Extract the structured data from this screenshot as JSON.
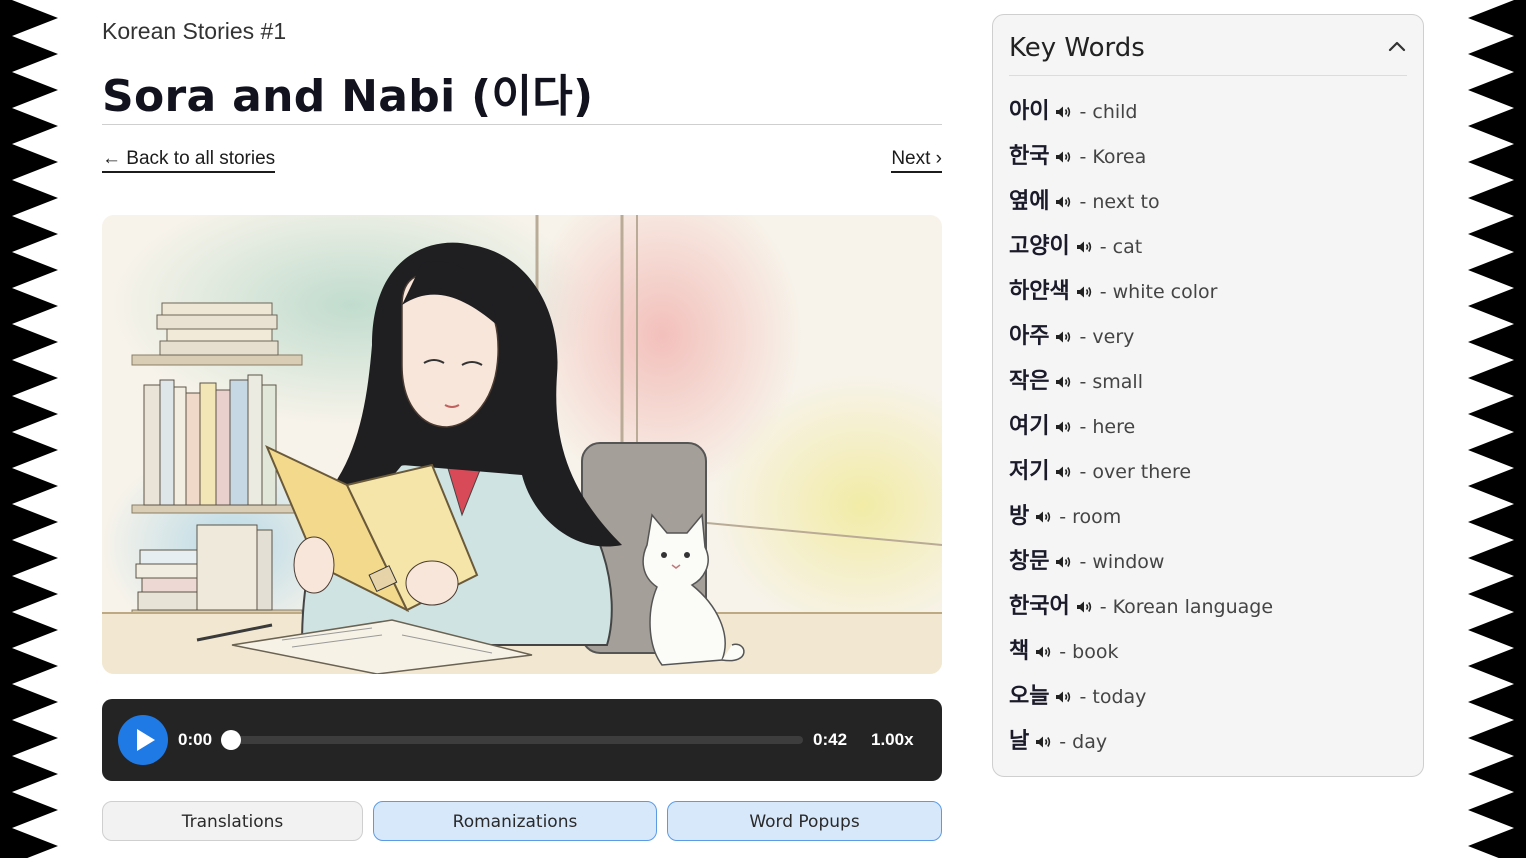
{
  "header": {
    "series": "Korean Stories #1",
    "title": "Sora and Nabi (이다)"
  },
  "nav": {
    "back": "← Back to all stories",
    "next": "Next ›"
  },
  "illustration": {
    "subject": "girl-reading-with-cat"
  },
  "player": {
    "current_time": "0:00",
    "duration": "0:42",
    "speed": "1.00x",
    "progress": 0,
    "play_icon": "play-icon",
    "accent_color": "#1f7ae6"
  },
  "toggles": [
    {
      "label": "Translations",
      "active": false
    },
    {
      "label": "Romanizations",
      "active": true
    },
    {
      "label": "Word Popups",
      "active": true
    }
  ],
  "key_words": {
    "title": "Key Words",
    "collapse_icon": "chevron-up-icon",
    "speaker_icon": "speaker-icon",
    "items": [
      {
        "korean": "아이",
        "english": "- child"
      },
      {
        "korean": "한국",
        "english": "- Korea"
      },
      {
        "korean": "옆에",
        "english": "- next to"
      },
      {
        "korean": "고양이",
        "english": "- cat"
      },
      {
        "korean": "하얀색",
        "english": "- white color"
      },
      {
        "korean": "아주",
        "english": "- very"
      },
      {
        "korean": "작은",
        "english": "- small"
      },
      {
        "korean": "여기",
        "english": "- here"
      },
      {
        "korean": "저기",
        "english": "- over there"
      },
      {
        "korean": "방",
        "english": "- room"
      },
      {
        "korean": "창문",
        "english": "- window"
      },
      {
        "korean": "한국어",
        "english": "- Korean language"
      },
      {
        "korean": "책",
        "english": "- book"
      },
      {
        "korean": "오늘",
        "english": "- today"
      },
      {
        "korean": "날",
        "english": "- day"
      }
    ]
  }
}
